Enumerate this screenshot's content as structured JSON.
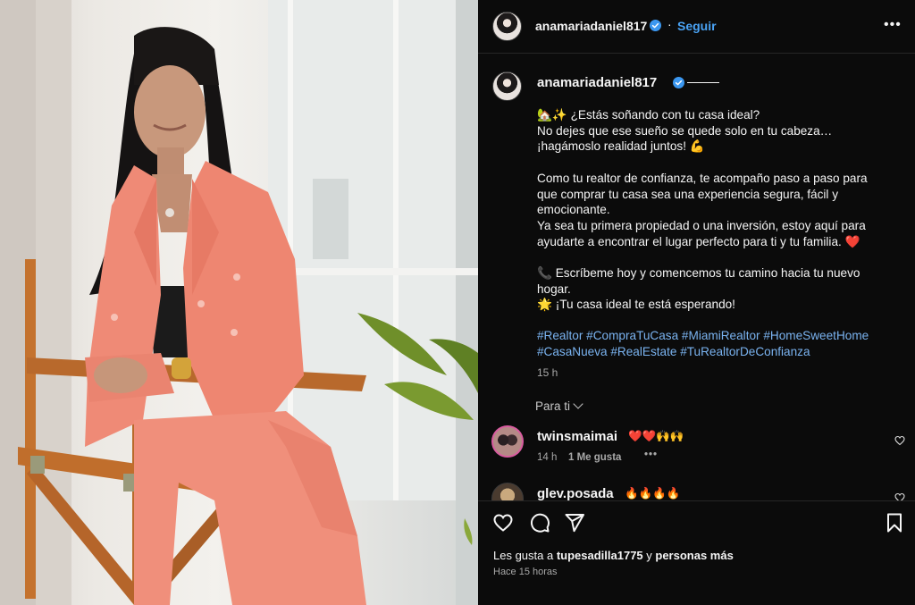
{
  "post": {
    "username": "anamariadaniel817",
    "follow_label": "Seguir",
    "more_label": "•••",
    "separator": "·"
  },
  "caption": {
    "username": "anamariadaniel817",
    "lines": [
      "🏡✨ ¿Estás soñando con tu casa ideal?",
      "No dejes que ese sueño se quede solo en tu cabeza…",
      "¡hagámoslo realidad juntos! 💪",
      "",
      "Como tu realtor de confianza, te acompaño paso a paso para",
      "que comprar tu casa sea una experiencia segura, fácil y",
      "emocionante.",
      "Ya sea tu primera propiedad o una inversión, estoy aquí para",
      "ayudarte a encontrar el lugar perfecto para ti y tu familia. ❤️",
      "",
      "📞 Escríbeme hoy y comencemos tu camino hacia tu nuevo",
      "hogar.",
      "🌟 ¡Tu casa ideal te está esperando!"
    ],
    "hashtags_line1": "#Realtor #CompraTuCasa #MiamiRealtor #HomeSweetHome",
    "hashtags_line2": "#CasaNueva #RealEstate #TuRealtorDeConfianza",
    "time": "15 h"
  },
  "comments": {
    "filter_label": "Para ti",
    "items": [
      {
        "username": "twinsmaimai",
        "text": "❤️❤️🙌🙌",
        "time": "14 h",
        "likes": "1 Me gusta",
        "more": "•••"
      },
      {
        "username": "glev.posada",
        "text": "🔥🔥🔥🔥"
      }
    ]
  },
  "footer": {
    "likes_prefix": "Les gusta a ",
    "likes_user": "tupesadilla1775",
    "likes_middle": " y ",
    "likes_suffix": "personas más",
    "time_ago": "Hace 15 horas"
  },
  "icons": {
    "verified": "verified-badge-icon",
    "like": "heart-icon",
    "comment": "comment-bubble-icon",
    "share": "paper-plane-icon",
    "save": "bookmark-icon",
    "more": "more-dots-icon"
  },
  "colors": {
    "link": "#4aa3f5",
    "hashtag": "#7ab3f0",
    "background": "#0b0b0b",
    "suit": "#ef8a76"
  }
}
